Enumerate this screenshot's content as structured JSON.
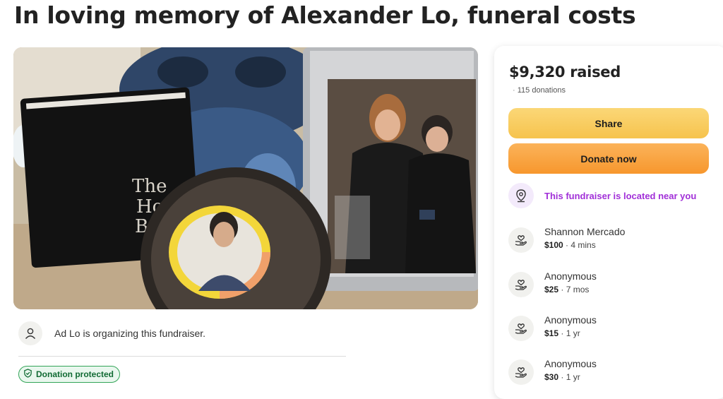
{
  "page": {
    "title": "In loving memory of Alexander Lo, funeral costs"
  },
  "hero_image": {
    "book_title_visible": "The Ho... B...",
    "book_title_lines": [
      "The",
      "Ho",
      "B"
    ]
  },
  "organizer": {
    "text": "Ad Lo is organizing this fundraiser."
  },
  "badge": {
    "label": "Donation protected"
  },
  "summary": {
    "raised": "$9,320 raised",
    "donations": "115 donations"
  },
  "buttons": {
    "share": "Share",
    "donate": "Donate now"
  },
  "location": {
    "text": "This fundraiser is located near you"
  },
  "donors": [
    {
      "name": "Shannon Mercado",
      "amount": "$100",
      "time": "4 mins"
    },
    {
      "name": "Anonymous",
      "amount": "$25",
      "time": "7 mos"
    },
    {
      "name": "Anonymous",
      "amount": "$15",
      "time": "1 yr"
    },
    {
      "name": "Anonymous",
      "amount": "$30",
      "time": "1 yr"
    }
  ],
  "colors": {
    "accent_purple": "#a12fd8",
    "share_yellow": "#f6c34d",
    "donate_orange": "#f7972d",
    "protected_green": "#32a457"
  },
  "icons": {
    "location": "map-pin-icon",
    "donor": "heart-hand-icon",
    "organizer": "user-icon",
    "badge": "shield-check-icon"
  }
}
